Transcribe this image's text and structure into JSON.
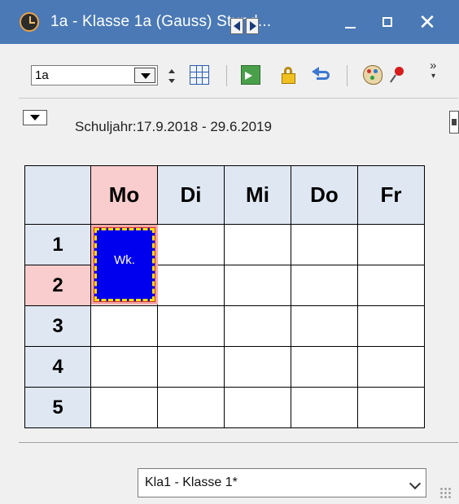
{
  "window": {
    "title": "1a - Klasse 1a (Gauss)  Stund...",
    "close_glyph": "✕"
  },
  "toolbar": {
    "class_value": "1a",
    "overflow_glyph": "»",
    "overflow_down_glyph": "▾"
  },
  "header": {
    "schoolyear": "Schuljahr:17.9.2018 - 29.6.2019"
  },
  "timetable": {
    "days": [
      "Mo",
      "Di",
      "Mi",
      "Do",
      "Fr"
    ],
    "active_day": "Mo",
    "periods": [
      "1",
      "2",
      "3",
      "4",
      "5"
    ],
    "active_period": "2",
    "lesson": {
      "label": "Wk.",
      "day": "Mo",
      "periods": [
        "1",
        "2"
      ],
      "color": "#0000ee",
      "highlight": "#f4a8a8"
    },
    "header_color": "#dfe7f2"
  },
  "footer": {
    "selected": "Kla1 - Klasse 1*"
  },
  "colors": {
    "titlebar": "#4a79b6",
    "accent_pink": "#f9cdcd"
  }
}
